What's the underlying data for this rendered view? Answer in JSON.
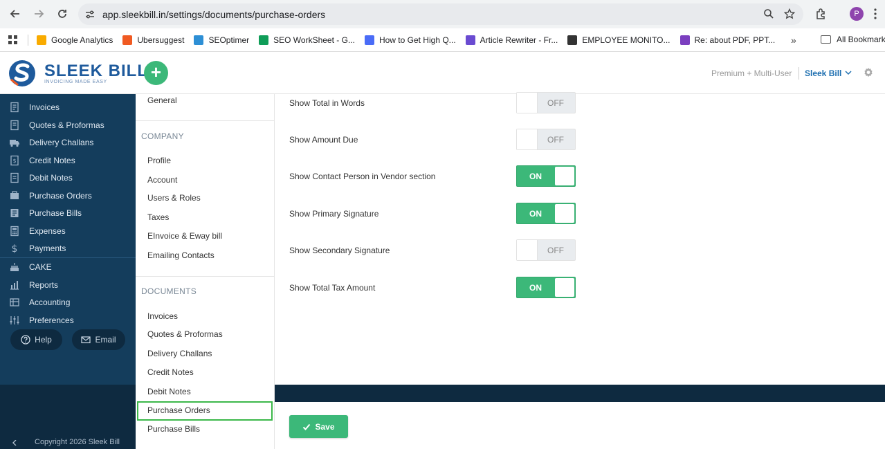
{
  "browser": {
    "url": "app.sleekbill.in/settings/documents/purchase-orders",
    "profile_initial": "P",
    "bookmarks": [
      {
        "label": "Google Analytics",
        "color": "#f9ab00"
      },
      {
        "label": "Ubersuggest",
        "color": "#f05a22"
      },
      {
        "label": "SEOptimer",
        "color": "#2d8fd5"
      },
      {
        "label": "SEO WorkSheet - G...",
        "color": "#0f9d58"
      },
      {
        "label": "How to Get High Q...",
        "color": "#4a6cf7"
      },
      {
        "label": "Article Rewriter - Fr...",
        "color": "#6a4bd1"
      },
      {
        "label": "EMPLOYEE MONITO...",
        "color": "#333333"
      },
      {
        "label": "Re: about PDF, PPT...",
        "color": "#7b3fbf"
      }
    ],
    "more_bookmarks": "»",
    "all_bookmarks": "All Bookmarks"
  },
  "header": {
    "logo_name": "SLEEK BILL",
    "logo_tagline": "INVOICING MADE EASY",
    "plan": "Premium + Multi-User",
    "company": "Sleek Bill",
    "add_label": "+"
  },
  "sidebar": {
    "items": [
      {
        "label": "Invoices",
        "icon": "invoice-icon"
      },
      {
        "label": "Quotes & Proformas",
        "icon": "quote-icon"
      },
      {
        "label": "Delivery Challans",
        "icon": "truck-icon"
      },
      {
        "label": "Credit Notes",
        "icon": "credit-note-icon"
      },
      {
        "label": "Debit Notes",
        "icon": "debit-note-icon"
      },
      {
        "label": "Purchase Orders",
        "icon": "purchase-order-icon"
      },
      {
        "label": "Purchase Bills",
        "icon": "purchase-bill-icon"
      },
      {
        "label": "Expenses",
        "icon": "calculator-icon"
      },
      {
        "label": "Payments",
        "icon": "dollar-icon"
      },
      {
        "label": "CAKE",
        "icon": "cake-icon"
      },
      {
        "label": "Reports",
        "icon": "reports-icon"
      },
      {
        "label": "Accounting",
        "icon": "accounting-icon"
      },
      {
        "label": "Preferences",
        "icon": "sliders-icon"
      }
    ],
    "help_label": "Help",
    "email_label": "Email",
    "copyright": "Copyright 2026 Sleek Bill"
  },
  "submenu": {
    "general": "General",
    "company_heading": "COMPANY",
    "company_items": [
      "Profile",
      "Account",
      "Users & Roles",
      "Taxes",
      "EInvoice & Eway bill",
      "Emailing Contacts"
    ],
    "documents_heading": "DOCUMENTS",
    "documents_items": [
      "Invoices",
      "Quotes & Proformas",
      "Delivery Challans",
      "Credit Notes",
      "Debit Notes",
      "Purchase Orders",
      "Purchase Bills"
    ],
    "active": "Purchase Orders"
  },
  "settings": {
    "on_text": "ON",
    "off_text": "OFF",
    "rows": [
      {
        "label": "Show Total in Words",
        "state": "off"
      },
      {
        "label": "Show Amount Due",
        "state": "off"
      },
      {
        "label": "Show Contact Person in Vendor section",
        "state": "on"
      },
      {
        "label": "Show Primary Signature",
        "state": "on"
      },
      {
        "label": "Show Secondary Signature",
        "state": "off"
      },
      {
        "label": "Show Total Tax Amount",
        "state": "on"
      }
    ]
  },
  "actions": {
    "save_label": "Save"
  },
  "colors": {
    "accent_green": "#3cb879",
    "sidebar_bg": "#143d5c",
    "sidebar_dark": "#0e2a40",
    "active_outline": "#3cb84a",
    "brand_blue": "#1e5a9c"
  }
}
